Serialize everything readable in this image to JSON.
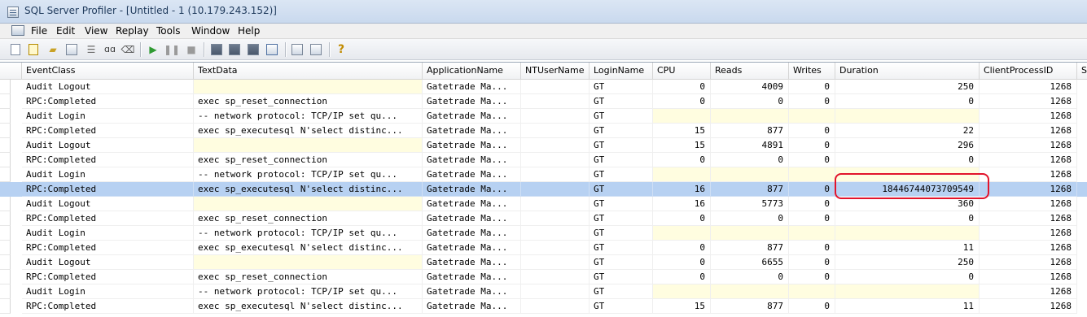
{
  "window": {
    "title": "SQL Server Profiler - [Untitled - 1 (10.179.243.152)]"
  },
  "menu": [
    "File",
    "Edit",
    "View",
    "Replay",
    "Tools",
    "Window",
    "Help"
  ],
  "toolbar_icons": [
    "new-trace-icon",
    "new-template-icon",
    "open-icon",
    "save-icon",
    "properties-icon",
    "find-icon",
    "clear-trace-icon",
    "start-trace-icon",
    "pause-trace-icon",
    "stop-trace-icon",
    "extract-icon",
    "display-icon",
    "script-icon",
    "auto-scroll-icon",
    "perfmon-icon",
    "compare-icon",
    "help-icon"
  ],
  "columns": [
    "EventClass",
    "TextData",
    "ApplicationName",
    "NTUserName",
    "LoginName",
    "CPU",
    "Reads",
    "Writes",
    "Duration",
    "ClientProcessID",
    "S"
  ],
  "rows": [
    {
      "EventClass": "Audit Logout",
      "TextData": "",
      "ApplicationName": "Gatetrade Ma...",
      "NTUserName": "",
      "LoginName": "GT",
      "CPU": "0",
      "Reads": "4009",
      "Writes": "0",
      "Duration": "250",
      "ClientProcessID": "1268"
    },
    {
      "EventClass": "RPC:Completed",
      "TextData": "exec sp_reset_connection",
      "ApplicationName": "Gatetrade Ma...",
      "NTUserName": "",
      "LoginName": "GT",
      "CPU": "0",
      "Reads": "0",
      "Writes": "0",
      "Duration": "0",
      "ClientProcessID": "1268"
    },
    {
      "EventClass": "Audit Login",
      "TextData": "-- network protocol: TCP/IP  set qu...",
      "ApplicationName": "Gatetrade Ma...",
      "NTUserName": "",
      "LoginName": "GT",
      "CPU": "",
      "Reads": "",
      "Writes": "",
      "Duration": "",
      "ClientProcessID": "1268"
    },
    {
      "EventClass": "RPC:Completed",
      "TextData": "exec sp_executesql N'select distinc...",
      "ApplicationName": "Gatetrade Ma...",
      "NTUserName": "",
      "LoginName": "GT",
      "CPU": "15",
      "Reads": "877",
      "Writes": "0",
      "Duration": "22",
      "ClientProcessID": "1268"
    },
    {
      "EventClass": "Audit Logout",
      "TextData": "",
      "ApplicationName": "Gatetrade Ma...",
      "NTUserName": "",
      "LoginName": "GT",
      "CPU": "15",
      "Reads": "4891",
      "Writes": "0",
      "Duration": "296",
      "ClientProcessID": "1268"
    },
    {
      "EventClass": "RPC:Completed",
      "TextData": "exec sp_reset_connection",
      "ApplicationName": "Gatetrade Ma...",
      "NTUserName": "",
      "LoginName": "GT",
      "CPU": "0",
      "Reads": "0",
      "Writes": "0",
      "Duration": "0",
      "ClientProcessID": "1268"
    },
    {
      "EventClass": "Audit Login",
      "TextData": "-- network protocol: TCP/IP  set qu...",
      "ApplicationName": "Gatetrade Ma...",
      "NTUserName": "",
      "LoginName": "GT",
      "CPU": "",
      "Reads": "",
      "Writes": "",
      "Duration": "",
      "ClientProcessID": "1268"
    },
    {
      "EventClass": "RPC:Completed",
      "TextData": "exec sp_executesql N'select distinc...",
      "ApplicationName": "Gatetrade Ma...",
      "NTUserName": "",
      "LoginName": "GT",
      "CPU": "16",
      "Reads": "877",
      "Writes": "0",
      "Duration": "18446744073709549",
      "ClientProcessID": "1268",
      "selected": true
    },
    {
      "EventClass": "Audit Logout",
      "TextData": "",
      "ApplicationName": "Gatetrade Ma...",
      "NTUserName": "",
      "LoginName": "GT",
      "CPU": "16",
      "Reads": "5773",
      "Writes": "0",
      "Duration": "360",
      "ClientProcessID": "1268"
    },
    {
      "EventClass": "RPC:Completed",
      "TextData": "exec sp_reset_connection",
      "ApplicationName": "Gatetrade Ma...",
      "NTUserName": "",
      "LoginName": "GT",
      "CPU": "0",
      "Reads": "0",
      "Writes": "0",
      "Duration": "0",
      "ClientProcessID": "1268"
    },
    {
      "EventClass": "Audit Login",
      "TextData": "-- network protocol: TCP/IP  set qu...",
      "ApplicationName": "Gatetrade Ma...",
      "NTUserName": "",
      "LoginName": "GT",
      "CPU": "",
      "Reads": "",
      "Writes": "",
      "Duration": "",
      "ClientProcessID": "1268"
    },
    {
      "EventClass": "RPC:Completed",
      "TextData": "exec sp_executesql N'select distinc...",
      "ApplicationName": "Gatetrade Ma...",
      "NTUserName": "",
      "LoginName": "GT",
      "CPU": "0",
      "Reads": "877",
      "Writes": "0",
      "Duration": "11",
      "ClientProcessID": "1268"
    },
    {
      "EventClass": "Audit Logout",
      "TextData": "",
      "ApplicationName": "Gatetrade Ma...",
      "NTUserName": "",
      "LoginName": "GT",
      "CPU": "0",
      "Reads": "6655",
      "Writes": "0",
      "Duration": "250",
      "ClientProcessID": "1268"
    },
    {
      "EventClass": "RPC:Completed",
      "TextData": "exec sp_reset_connection",
      "ApplicationName": "Gatetrade Ma...",
      "NTUserName": "",
      "LoginName": "GT",
      "CPU": "0",
      "Reads": "0",
      "Writes": "0",
      "Duration": "0",
      "ClientProcessID": "1268"
    },
    {
      "EventClass": "Audit Login",
      "TextData": "-- network protocol: TCP/IP  set qu...",
      "ApplicationName": "Gatetrade Ma...",
      "NTUserName": "",
      "LoginName": "GT",
      "CPU": "",
      "Reads": "",
      "Writes": "",
      "Duration": "",
      "ClientProcessID": "1268"
    },
    {
      "EventClass": "RPC:Completed",
      "TextData": "exec sp_executesql N'select distinc...",
      "ApplicationName": "Gatetrade Ma...",
      "NTUserName": "",
      "LoginName": "GT",
      "CPU": "15",
      "Reads": "877",
      "Writes": "0",
      "Duration": "11",
      "ClientProcessID": "1268"
    }
  ],
  "colors": {
    "selected_row": "#b7d1f2",
    "empty_cell": "#fffde0",
    "highlight": "#e2142c"
  }
}
